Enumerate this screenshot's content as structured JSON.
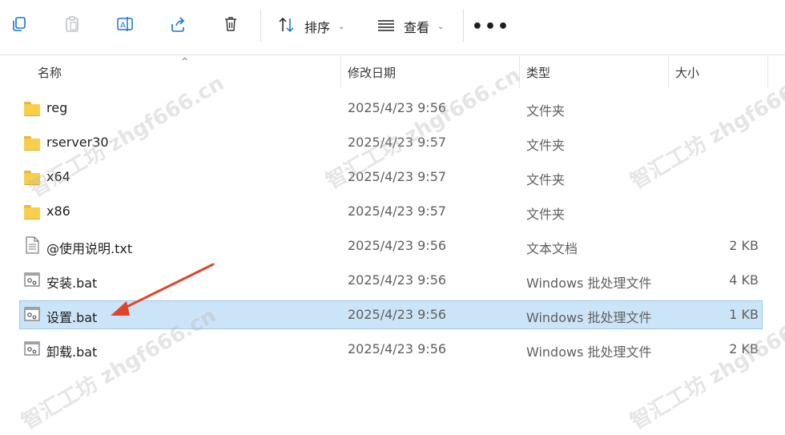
{
  "toolbar": {
    "sort_label": "排序",
    "view_label": "查看",
    "more_label": "•••",
    "chevron": "⌄"
  },
  "header": {
    "name": "名称",
    "modified": "修改日期",
    "type": "类型",
    "size": "大小",
    "sort_caret": "^"
  },
  "files": [
    {
      "name": "reg",
      "date": "2025/4/23 9:56",
      "type": "文件夹",
      "size": "",
      "icon": "folder-icon"
    },
    {
      "name": "rserver30",
      "date": "2025/4/23 9:57",
      "type": "文件夹",
      "size": "",
      "icon": "folder-icon"
    },
    {
      "name": "x64",
      "date": "2025/4/23 9:57",
      "type": "文件夹",
      "size": "",
      "icon": "folder-icon"
    },
    {
      "name": "x86",
      "date": "2025/4/23 9:57",
      "type": "文件夹",
      "size": "",
      "icon": "folder-icon"
    },
    {
      "name": "@使用说明.txt",
      "date": "2025/4/23 9:56",
      "type": "文本文档",
      "size": "2 KB",
      "icon": "text-file-icon"
    },
    {
      "name": "安装.bat",
      "date": "2025/4/23 9:56",
      "type": "Windows 批处理文件",
      "size": "4 KB",
      "icon": "batch-file-icon"
    },
    {
      "name": "设置.bat",
      "date": "2025/4/23 9:56",
      "type": "Windows 批处理文件",
      "size": "1 KB",
      "icon": "batch-file-icon",
      "selected": true
    },
    {
      "name": "卸载.bat",
      "date": "2025/4/23 9:56",
      "type": "Windows 批处理文件",
      "size": "2 KB",
      "icon": "batch-file-icon"
    }
  ],
  "watermark": "智汇工坊 zhgf666.cn",
  "colors": {
    "selection_bg": "#cce4f7",
    "selection_border": "#99c9ef",
    "arrow": "#e0452b",
    "folder": "#f7cf4c"
  }
}
